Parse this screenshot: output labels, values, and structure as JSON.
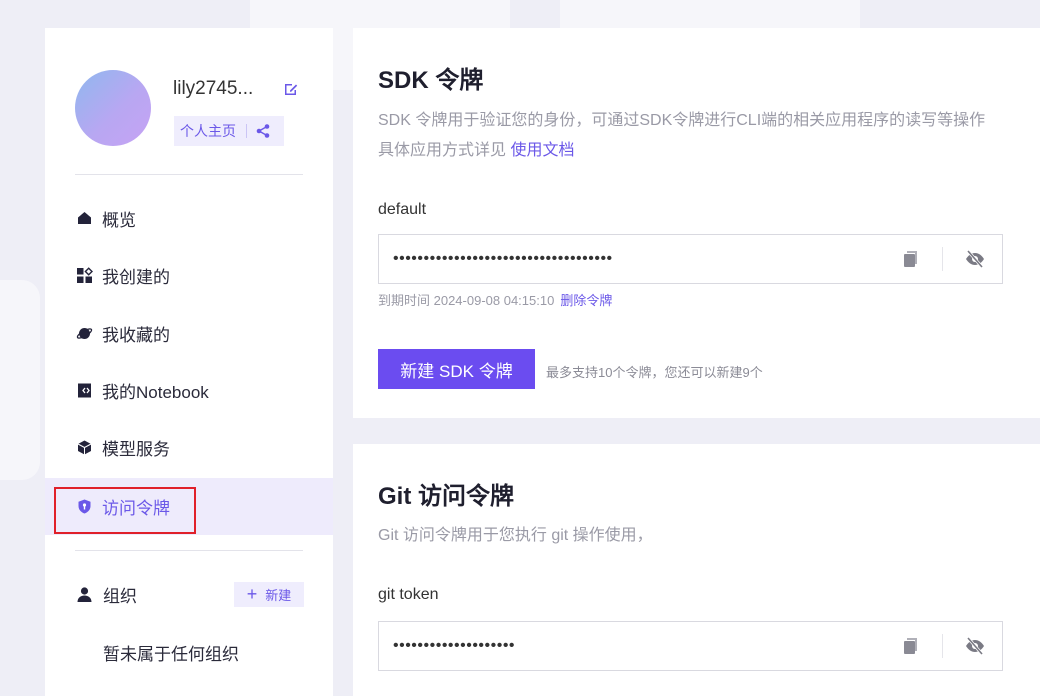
{
  "sidebar": {
    "username": "lily2745...",
    "profile_link": "个人主页",
    "nav": [
      {
        "label": "概览",
        "icon": "home-icon"
      },
      {
        "label": "我创建的",
        "icon": "grid-icon"
      },
      {
        "label": "我收藏的",
        "icon": "planet-icon"
      },
      {
        "label": "我的Notebook",
        "icon": "notebook-icon"
      },
      {
        "label": "模型服务",
        "icon": "cube-icon"
      },
      {
        "label": "访问令牌",
        "icon": "shield-icon",
        "active": true
      }
    ],
    "org_label": "组织",
    "org_new_label": "新建",
    "org_empty": "暂未属于任何组织"
  },
  "sdk": {
    "title": "SDK 令牌",
    "desc_line1": "SDK 令牌用于验证您的身份，可通过SDK令牌进行CLI端的相关应用程序的读写等操作",
    "desc_line2": "具体应用方式详见",
    "doc_link": "使用文档",
    "token_label": "default",
    "token_value": "••••••••••••••••••••••••••••••••••••",
    "expire_text": "到期时间 2024-09-08 04:15:10",
    "delete_label": "删除令牌",
    "create_button": "新建 SDK 令牌",
    "limit_text": "最多支持10个令牌，您还可以新建9个"
  },
  "git": {
    "title": "Git 访问令牌",
    "desc": "Git 访问令牌用于您执行 git 操作使用，",
    "token_label": "git token",
    "token_value": "••••••••••••••••••••"
  },
  "colors": {
    "accent": "#6b58e8",
    "button": "#6b4cf0",
    "highlight": "#e0202a"
  }
}
